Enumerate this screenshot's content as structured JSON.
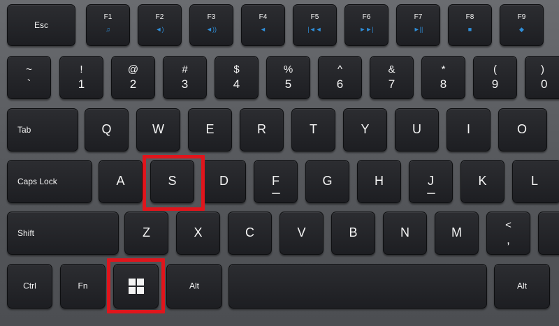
{
  "keys": {
    "esc": "Esc",
    "f1": "F1",
    "f1_icon": "♫",
    "f2": "F2",
    "f2_icon": "◄)",
    "f3": "F3",
    "f3_icon": "◄))",
    "f4": "F4",
    "f4_icon": "◄",
    "f5": "F5",
    "f5_icon": "|◄◄",
    "f6": "F6",
    "f6_icon": "►►|",
    "f7": "F7",
    "f7_icon": "►||",
    "f8": "F8",
    "f8_icon": "■",
    "f9": "F9",
    "f9_icon": "◆",
    "tilde_top": "~",
    "tilde_bot": "`",
    "k1_top": "!",
    "k1_bot": "1",
    "k2_top": "@",
    "k2_bot": "2",
    "k3_top": "#",
    "k3_bot": "3",
    "k4_top": "$",
    "k4_bot": "4",
    "k5_top": "%",
    "k5_bot": "5",
    "k6_top": "^",
    "k6_bot": "6",
    "k7_top": "&",
    "k7_bot": "7",
    "k8_top": "*",
    "k8_bot": "8",
    "k9_top": "(",
    "k9_bot": "9",
    "k0_top": ")",
    "k0_bot": "0",
    "tab": "Tab",
    "q": "Q",
    "w": "W",
    "e": "E",
    "r": "R",
    "t": "T",
    "y": "Y",
    "u": "U",
    "i": "I",
    "o": "O",
    "caps": "Caps Lock",
    "a": "A",
    "s": "S",
    "d": "D",
    "f": "F",
    "g": "G",
    "h": "H",
    "j": "J",
    "k": "K",
    "l": "L",
    "shift": "Shift",
    "z": "Z",
    "x": "X",
    "c": "C",
    "v": "V",
    "b": "B",
    "n": "N",
    "m": "M",
    "comma_top": "<",
    "comma_bot": ",",
    "ctrl": "Ctrl",
    "fn": "Fn",
    "alt_left": "Alt",
    "alt_right": "Alt"
  },
  "highlight_color": "#e0151c",
  "icon_color": "#2f8ed8"
}
